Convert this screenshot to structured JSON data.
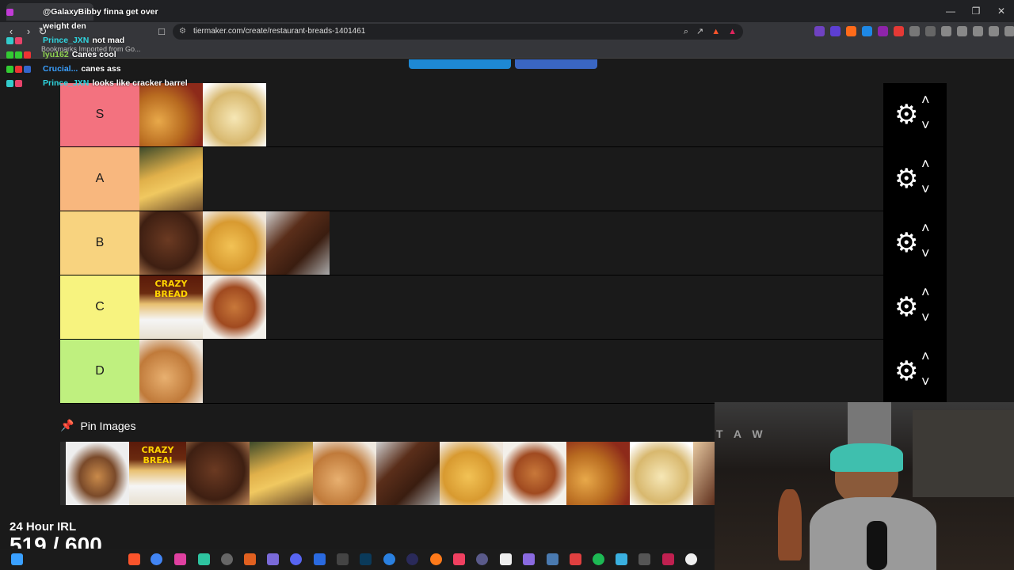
{
  "browser": {
    "url": "tiermaker.com/create/restaurant-breads-1401461",
    "bookmark_text": "Bookmarks   Imported from Go..."
  },
  "tiers": [
    {
      "label": "S",
      "color": "#ff7f7f"
    },
    {
      "label": "A",
      "color": "#ffbf7f"
    },
    {
      "label": "B",
      "color": "#ffdf7f"
    },
    {
      "label": "C",
      "color": "#ffff7f"
    },
    {
      "label": "D",
      "color": "#bfff7f"
    }
  ],
  "tier_images_captions": {
    "crazy_bread": "CRAZY BREAD"
  },
  "pin": {
    "title": "Pin Images",
    "crazy_bread": "CRAZY BREAI"
  },
  "chat": [
    {
      "user": "",
      "msg": "@GalaxyBibby finna get over"
    },
    {
      "user": "",
      "msg": "weight den"
    },
    {
      "user": "Prince_JXN",
      "msg": "not mad"
    },
    {
      "user": "lyu162",
      "msg": "Canes cool"
    },
    {
      "user": "Crucial...",
      "msg": "canes ass"
    },
    {
      "user": "Prince_JXN",
      "msg": "looks like cracker barrel"
    }
  ],
  "overlay": {
    "goal_title": "24 Hour IRL",
    "goal_count": "519 / 600",
    "cam_sign": "T A W"
  }
}
